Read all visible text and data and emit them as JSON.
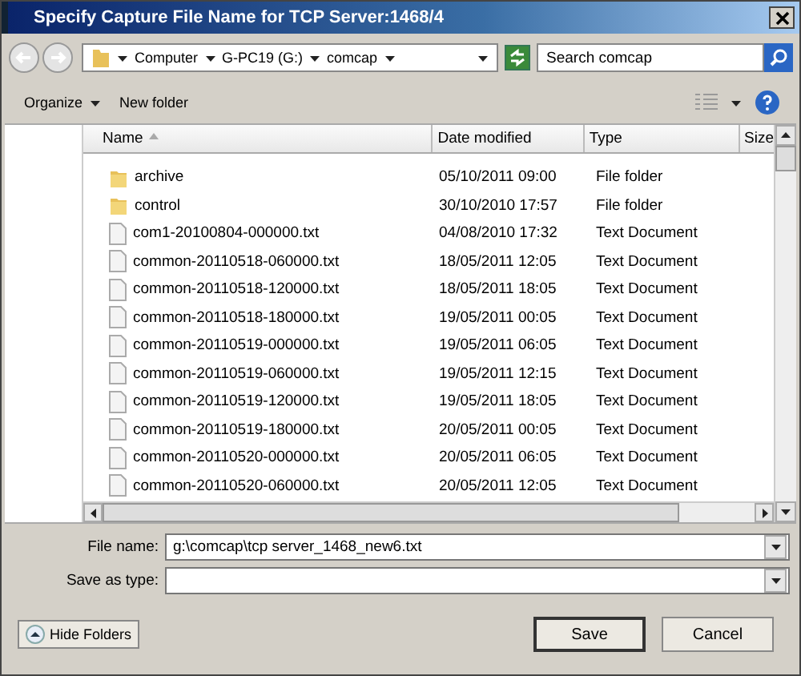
{
  "window": {
    "title": "Specify Capture File Name for TCP Server:1468/4"
  },
  "breadcrumb": [
    "Computer",
    "G-PC19 (G:)",
    "comcap"
  ],
  "search": {
    "placeholder": "Search comcap"
  },
  "toolbar": [
    "Organize",
    "New folder"
  ],
  "table": {
    "columns": [
      "Name",
      "Date modified",
      "Type",
      "Size"
    ],
    "rows": [
      {
        "kind": "folder",
        "name": "archive",
        "date": "05/10/2011 09:00",
        "type": "File folder"
      },
      {
        "kind": "folder",
        "name": "control",
        "date": "30/10/2010 17:57",
        "type": "File folder"
      },
      {
        "kind": "file",
        "name": "com1-20100804-000000.txt",
        "date": "04/08/2010 17:32",
        "type": "Text Document"
      },
      {
        "kind": "file",
        "name": "common-20110518-060000.txt",
        "date": "18/05/2011 12:05",
        "type": "Text Document"
      },
      {
        "kind": "file",
        "name": "common-20110518-120000.txt",
        "date": "18/05/2011 18:05",
        "type": "Text Document"
      },
      {
        "kind": "file",
        "name": "common-20110518-180000.txt",
        "date": "19/05/2011 00:05",
        "type": "Text Document"
      },
      {
        "kind": "file",
        "name": "common-20110519-000000.txt",
        "date": "19/05/2011 06:05",
        "type": "Text Document"
      },
      {
        "kind": "file",
        "name": "common-20110519-060000.txt",
        "date": "19/05/2011 12:15",
        "type": "Text Document"
      },
      {
        "kind": "file",
        "name": "common-20110519-120000.txt",
        "date": "19/05/2011 18:05",
        "type": "Text Document"
      },
      {
        "kind": "file",
        "name": "common-20110519-180000.txt",
        "date": "20/05/2011 00:05",
        "type": "Text Document"
      },
      {
        "kind": "file",
        "name": "common-20110520-000000.txt",
        "date": "20/05/2011 06:05",
        "type": "Text Document"
      },
      {
        "kind": "file",
        "name": "common-20110520-060000.txt",
        "date": "20/05/2011 12:05",
        "type": "Text Document"
      }
    ]
  },
  "file_name": {
    "label": "File name:",
    "value": "g:\\comcap\\tcp server_1468_new6.txt"
  },
  "save_as_type": {
    "label": "Save as type:"
  },
  "hide_folders": "Hide Folders",
  "buttons": [
    "Save",
    "Cancel"
  ]
}
